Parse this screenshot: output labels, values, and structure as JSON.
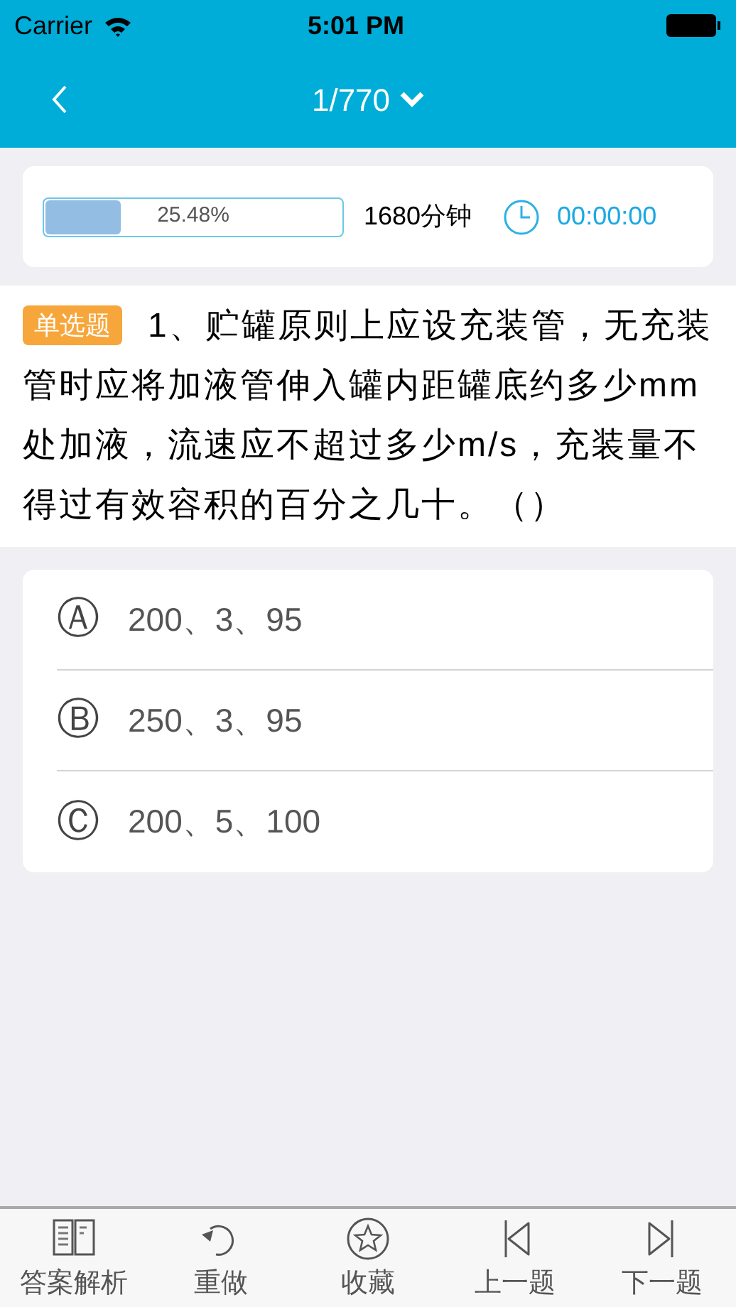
{
  "status_bar": {
    "carrier": "Carrier",
    "time": "5:01 PM"
  },
  "nav": {
    "title": "1/770"
  },
  "progress": {
    "level": 0.2548,
    "reading": "25.48%",
    "duration": "1680分钟",
    "timer": "00:00:00"
  },
  "question": {
    "type": "单选题",
    "text": "1、贮罐原则上应设充装管，无充装管时应将加液管伸入罐内距罐底约多少mm处加液，流速应不超过多少m/s，充装量不得过有效容积的百分之几十。（）"
  },
  "options": [
    {
      "marker": "Ⓐ",
      "text": "200、3、95"
    },
    {
      "marker": "Ⓑ",
      "text": "250、3、95"
    },
    {
      "marker": "Ⓒ",
      "text": "200、5、100"
    }
  ],
  "toolbar": [
    {
      "kind": "book",
      "label": "答案解析"
    },
    {
      "kind": "redo",
      "label": "重做"
    },
    {
      "kind": "star",
      "label": "收藏"
    },
    {
      "kind": "prev",
      "label": "上一题"
    },
    {
      "kind": "next",
      "label": "下一题"
    }
  ]
}
